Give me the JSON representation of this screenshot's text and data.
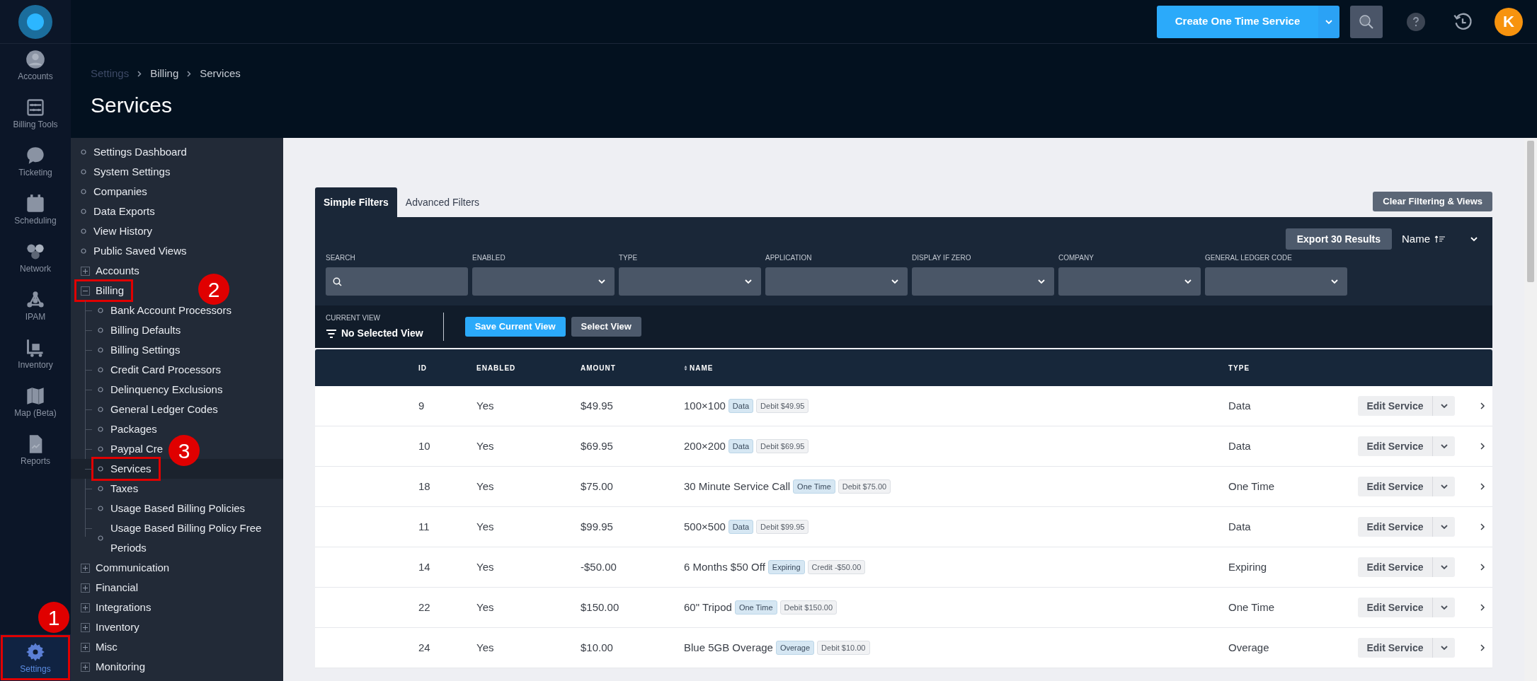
{
  "topbar": {
    "create_button": "Create One Time Service",
    "avatar": "K"
  },
  "nav": [
    {
      "label": "Accounts",
      "selected": false
    },
    {
      "label": "Billing Tools",
      "selected": false
    },
    {
      "label": "Ticketing",
      "selected": false
    },
    {
      "label": "Scheduling",
      "selected": false
    },
    {
      "label": "Network",
      "selected": false
    },
    {
      "label": "IPAM",
      "selected": false
    },
    {
      "label": "Inventory",
      "selected": false
    },
    {
      "label": "Map (Beta)",
      "selected": false
    },
    {
      "label": "Reports",
      "selected": false
    },
    {
      "label": "Settings",
      "selected": true,
      "marker": "1"
    }
  ],
  "breadcrumb": [
    "Settings",
    "Billing",
    "Services"
  ],
  "title": "Services",
  "tree": [
    {
      "label": "Settings Dashboard",
      "kind": "leaf"
    },
    {
      "label": "System Settings",
      "kind": "leaf"
    },
    {
      "label": "Companies",
      "kind": "leaf"
    },
    {
      "label": "Data Exports",
      "kind": "leaf"
    },
    {
      "label": "View History",
      "kind": "leaf"
    },
    {
      "label": "Public Saved Views",
      "kind": "leaf"
    },
    {
      "label": "Accounts",
      "kind": "group",
      "expanded": false
    },
    {
      "label": "Billing",
      "kind": "group",
      "expanded": true,
      "marker": "2",
      "children": [
        {
          "label": "Bank Account Processors",
          "selected": false
        },
        {
          "label": "Billing Defaults",
          "selected": false
        },
        {
          "label": "Billing Settings",
          "selected": false
        },
        {
          "label": "Credit Card Processors",
          "selected": false
        },
        {
          "label": "Delinquency Exclusions",
          "selected": false
        },
        {
          "label": "General Ledger Codes",
          "selected": false
        },
        {
          "label": "Packages",
          "selected": false
        },
        {
          "label": "Paypal Cre",
          "selected": false,
          "marker": "3"
        },
        {
          "label": "Services",
          "selected": true
        },
        {
          "label": "Taxes",
          "selected": false
        },
        {
          "label": "Usage Based Billing Policies",
          "selected": false
        },
        {
          "label": "Usage Based Billing Policy Free Periods",
          "selected": false
        }
      ]
    },
    {
      "label": "Communication",
      "kind": "group",
      "expanded": false
    },
    {
      "label": "Financial",
      "kind": "group",
      "expanded": false
    },
    {
      "label": "Integrations",
      "kind": "group",
      "expanded": false
    },
    {
      "label": "Inventory",
      "kind": "group",
      "expanded": false
    },
    {
      "label": "Misc",
      "kind": "group",
      "expanded": false
    },
    {
      "label": "Monitoring",
      "kind": "group",
      "expanded": false
    }
  ],
  "filter_tabs": [
    {
      "label": "Simple Filters",
      "selected": true
    },
    {
      "label": "Advanced Filters",
      "selected": false
    }
  ],
  "clear_button": "Clear Filtering & Views",
  "export_button": "Export 30 Results",
  "sort": "Name",
  "filters": [
    {
      "label": "SEARCH",
      "kind": "search"
    },
    {
      "label": "ENABLED",
      "kind": "select"
    },
    {
      "label": "TYPE",
      "kind": "select"
    },
    {
      "label": "APPLICATION",
      "kind": "select"
    },
    {
      "label": "DISPLAY IF ZERO",
      "kind": "select"
    },
    {
      "label": "COMPANY",
      "kind": "select"
    },
    {
      "label": "GENERAL LEDGER CODE",
      "kind": "select"
    }
  ],
  "current_view": {
    "label": "CURRENT VIEW",
    "value": "No Selected View"
  },
  "view_buttons": [
    {
      "label": "Save Current View",
      "kind": "primary"
    },
    {
      "label": "Select View",
      "kind": "secondary"
    }
  ],
  "table": {
    "columns": [
      "ID",
      "ENABLED",
      "AMOUNT",
      "NAME",
      "TYPE"
    ],
    "rows": [
      {
        "id": "9",
        "enabled": "Yes",
        "amount": "$49.95",
        "name": "100×100",
        "tags": [
          {
            "label": "Data",
            "kind": "type"
          },
          {
            "label": "Debit $49.95",
            "kind": "charge"
          }
        ],
        "type": "Data",
        "action": "Edit Service"
      },
      {
        "id": "10",
        "enabled": "Yes",
        "amount": "$69.95",
        "name": "200×200",
        "tags": [
          {
            "label": "Data",
            "kind": "type"
          },
          {
            "label": "Debit $69.95",
            "kind": "charge"
          }
        ],
        "type": "Data",
        "action": "Edit Service"
      },
      {
        "id": "18",
        "enabled": "Yes",
        "amount": "$75.00",
        "name": "30 Minute Service Call",
        "tags": [
          {
            "label": "One Time",
            "kind": "type"
          },
          {
            "label": "Debit $75.00",
            "kind": "charge"
          }
        ],
        "type": "One Time",
        "action": "Edit Service"
      },
      {
        "id": "11",
        "enabled": "Yes",
        "amount": "$99.95",
        "name": "500×500",
        "tags": [
          {
            "label": "Data",
            "kind": "type"
          },
          {
            "label": "Debit $99.95",
            "kind": "charge"
          }
        ],
        "type": "Data",
        "action": "Edit Service"
      },
      {
        "id": "14",
        "enabled": "Yes",
        "amount": "-$50.00",
        "name": "6 Months $50 Off",
        "tags": [
          {
            "label": "Expiring",
            "kind": "type"
          },
          {
            "label": "Credit -$50.00",
            "kind": "charge"
          }
        ],
        "type": "Expiring",
        "action": "Edit Service"
      },
      {
        "id": "22",
        "enabled": "Yes",
        "amount": "$150.00",
        "name": "60\" Tripod",
        "tags": [
          {
            "label": "One Time",
            "kind": "type"
          },
          {
            "label": "Debit $150.00",
            "kind": "charge"
          }
        ],
        "type": "One Time",
        "action": "Edit Service"
      },
      {
        "id": "24",
        "enabled": "Yes",
        "amount": "$10.00",
        "name": "Blue 5GB Overage",
        "tags": [
          {
            "label": "Overage",
            "kind": "type"
          },
          {
            "label": "Debit $10.00",
            "kind": "charge"
          }
        ],
        "type": "Overage",
        "action": "Edit Service"
      }
    ]
  }
}
